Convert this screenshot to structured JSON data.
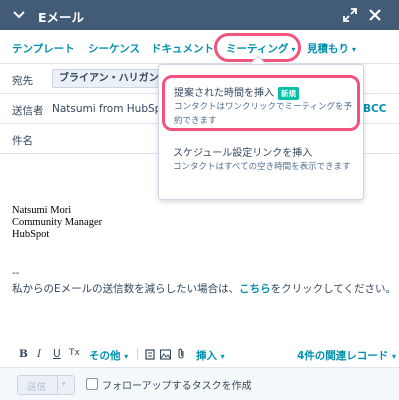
{
  "window": {
    "title": "Eメール"
  },
  "toolbar": {
    "items": [
      {
        "label": "テンプレート"
      },
      {
        "label": "シーケンス"
      },
      {
        "label": "ドキュメント"
      },
      {
        "label": "ミーティング",
        "caret": "▾"
      },
      {
        "label": "見積もり",
        "caret": "▾"
      }
    ]
  },
  "fields": {
    "to_label": "宛先",
    "recipient": "ブライアン・ハリガン",
    "recipient_info": "i",
    "recipient_remove": "×",
    "from_label": "送信者",
    "from_value": "Natsumi from HubSpot (n",
    "bcc_label": "BCC",
    "subject_label": "件名"
  },
  "body": {
    "signature_lines": [
      "Natsumi Mori",
      "Community Manager",
      "HubSpot"
    ],
    "separator": "--",
    "optout_prefix": "私からのEメールの送信数を減らしたい場合は、",
    "optout_link": "こちら",
    "optout_suffix": "をクリックしてください。"
  },
  "format_bar": {
    "bold": "B",
    "italic": "I",
    "underline": "U",
    "strike": "Tx",
    "more": "その他",
    "insert": "挿入",
    "records": "4件の関連レコード",
    "caret": "▾"
  },
  "footer": {
    "send_label": "送信",
    "send_caret": "▾",
    "followup_label": "フォローアップするタスクを作成",
    "followup_checked": false
  },
  "meeting_menu": {
    "items": [
      {
        "title": "提案された時間を挿入",
        "badge": "新規",
        "description": "コンタクトはワンクリックでミーティングを予約できます"
      },
      {
        "title": "スケジュール設定リンクを挿入",
        "description": "コンタクトはすべての空き時間を表示できます"
      }
    ]
  },
  "colors": {
    "header_bg": "#425b76",
    "link": "#0091ae",
    "highlight_ring": "#f2547d",
    "badge_new": "#00bda5",
    "text": "#33475b"
  }
}
